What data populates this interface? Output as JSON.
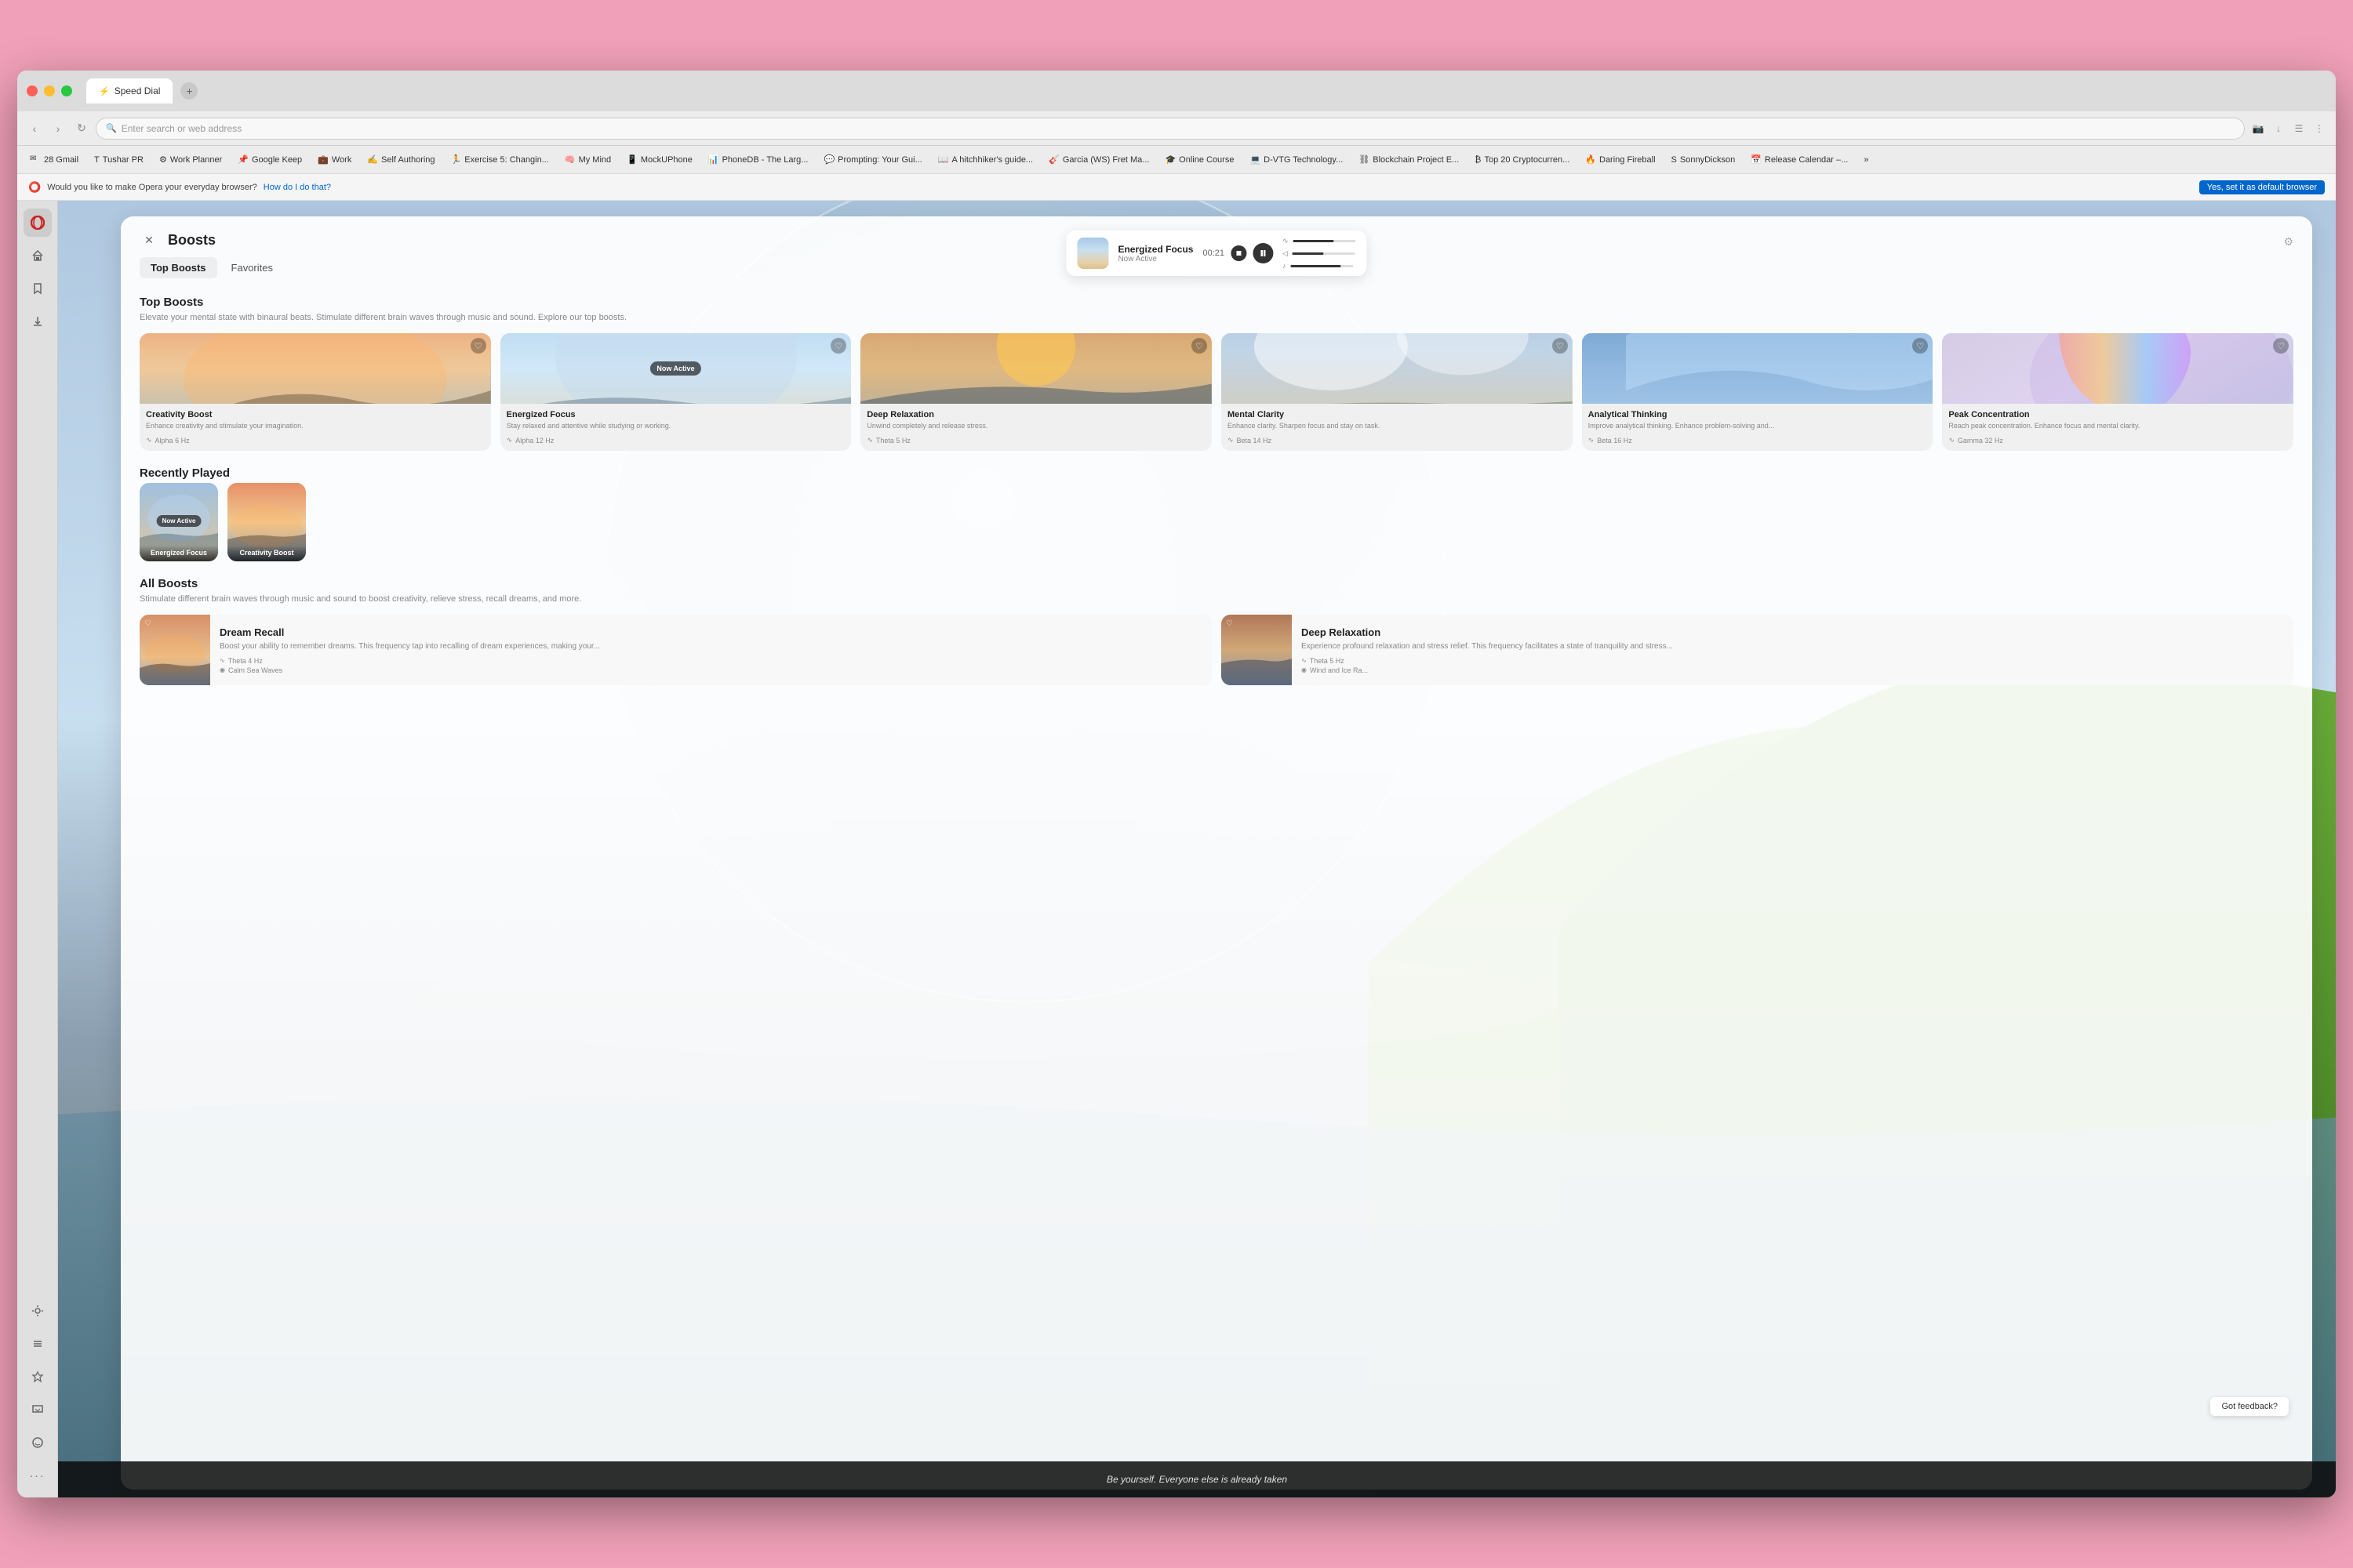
{
  "browser": {
    "tab_title": "Speed Dial",
    "tab_add_icon": "+",
    "nav": {
      "back": "‹",
      "forward": "›",
      "reload": "↻",
      "home": "⌂",
      "address_placeholder": "Enter search or web address",
      "address_text": ""
    },
    "bookmarks": [
      {
        "label": "28 Gmail",
        "icon": "✉"
      },
      {
        "label": "Tushar PR",
        "icon": "T"
      },
      {
        "label": "Work Planner",
        "icon": "📋"
      },
      {
        "label": "Google Keep",
        "icon": "📌"
      },
      {
        "label": "Work",
        "icon": "💼"
      },
      {
        "label": "Self Authoring",
        "icon": "✍"
      },
      {
        "label": "Exercise 5: Changin...",
        "icon": "🏃"
      },
      {
        "label": "My Mind",
        "icon": "🧠"
      },
      {
        "label": "MockUPhone",
        "icon": "📱"
      },
      {
        "label": "PhoneDB - The Larg...",
        "icon": "📊"
      },
      {
        "label": "Prompting: Your Gui...",
        "icon": "💬"
      },
      {
        "label": "A hitchhiker's guide...",
        "icon": "📖"
      },
      {
        "label": "Garcia (WS) Fret Ma...",
        "icon": "🎸"
      },
      {
        "label": "Online Course",
        "icon": "🎓"
      },
      {
        "label": "D-VTG Technology...",
        "icon": "💻"
      },
      {
        "label": "Blockchain Project E...",
        "icon": "⛓"
      },
      {
        "label": "Top 20 Cryptocurren...",
        "icon": "₿"
      },
      {
        "label": "Daring Fireball",
        "icon": "🔥"
      },
      {
        "label": "SonnyDickson",
        "icon": "S"
      },
      {
        "label": "Release Calendar –...",
        "icon": "📅"
      }
    ],
    "default_bar": {
      "text": "Would you like to make Opera your everyday browser?",
      "link": "How do I do that?",
      "cta": "Yes, set it as default browser"
    }
  },
  "sidebar": {
    "icons": [
      {
        "name": "opera-icon",
        "symbol": "O"
      },
      {
        "name": "home-icon",
        "symbol": "⌂"
      },
      {
        "name": "bookmarks-icon",
        "symbol": "☆"
      },
      {
        "name": "downloads-icon",
        "symbol": "↓"
      },
      {
        "name": "history-icon",
        "symbol": "🕐"
      },
      {
        "name": "settings-icon",
        "symbol": "⚙"
      },
      {
        "name": "extensions-icon",
        "symbol": "☰"
      },
      {
        "name": "ai-icon",
        "symbol": "✦"
      },
      {
        "name": "messenger-icon",
        "symbol": "💬"
      },
      {
        "name": "whatsapp-icon",
        "symbol": "📲"
      },
      {
        "name": "more-icon",
        "symbol": "···"
      }
    ]
  },
  "now_playing": {
    "title": "Energized Focus",
    "status": "Now Active",
    "time": "00:21",
    "slider1_pct": 65,
    "slider2_pct": 50,
    "slider3_pct": 80
  },
  "boosts": {
    "panel_title": "Boosts",
    "close_icon": "✕",
    "settings_icon": "⚙",
    "tabs": [
      {
        "label": "Top Boosts",
        "active": true
      },
      {
        "label": "Favorites",
        "active": false
      }
    ],
    "top_section_title": "Top Boosts",
    "top_section_desc": "Elevate your mental state with binaural beats. Stimulate different brain waves through music and sound. Explore our top boosts.",
    "top_boosts": [
      {
        "name": "Creativity Boost",
        "desc": "Enhance creativity and stimulate your imagination.",
        "freq": "Alpha 6 Hz",
        "sky": "sky-dawn",
        "now_active": false,
        "hearted": false
      },
      {
        "name": "Energized Focus",
        "desc": "Stay relaxed and attentive while studying or working.",
        "freq": "Alpha 12 Hz",
        "sky": "sky-blue",
        "now_active": true,
        "hearted": false
      },
      {
        "name": "Deep Relaxation",
        "desc": "Unwind completely and release stress.",
        "freq": "Theta 5 Hz",
        "sky": "sky-sunset",
        "now_active": false,
        "hearted": false
      },
      {
        "name": "Mental Clarity",
        "desc": "Enhance clarity. Sharpen focus and stay on task.",
        "freq": "Beta 14 Hz",
        "sky": "sky-clouds",
        "now_active": false,
        "hearted": false
      },
      {
        "name": "Analytical Thinking",
        "desc": "Improve analytical thinking. Enhance problem-solving and...",
        "freq": "Beta 16 Hz",
        "sky": "sky-azure",
        "now_active": false,
        "hearted": false
      },
      {
        "name": "Peak Concentration",
        "desc": "Reach peak concentration. Enhance focus and mental clarity.",
        "freq": "Gamma 32 Hz",
        "sky": "sky-pearl",
        "now_active": false,
        "hearted": false
      }
    ],
    "recently_played_title": "Recently Played",
    "recently_played": [
      {
        "name": "Energized Focus",
        "sky": "sky-blue",
        "now_active": true
      },
      {
        "name": "Creativity Boost",
        "sky": "sky-dawn",
        "now_active": false
      }
    ],
    "all_boosts_title": "All Boosts",
    "all_boosts_desc": "Stimulate different brain waves through music and sound to boost creativity, relieve stress, recall dreams, and more.",
    "all_boosts": [
      {
        "name": "Dream Recall",
        "desc": "Boost your ability to remember dreams. This frequency tap into recalling of dream experiences, making your...",
        "freq": "Theta 4 Hz",
        "track": "Calm Sea Waves",
        "sky": "sky-dawn",
        "hearted": false
      },
      {
        "name": "Deep Relaxation",
        "desc": "Experience profound relaxation and stress relief. This frequency facilitates a state of tranquility and stress...",
        "freq": "Theta 5 Hz",
        "track": "Wind and Ice Ra...",
        "sky": "sky-sunset",
        "hearted": false
      }
    ]
  },
  "footer": {
    "quote": "Be yourself. Everyone else is already taken",
    "feedback_btn": "Got feedback?"
  }
}
